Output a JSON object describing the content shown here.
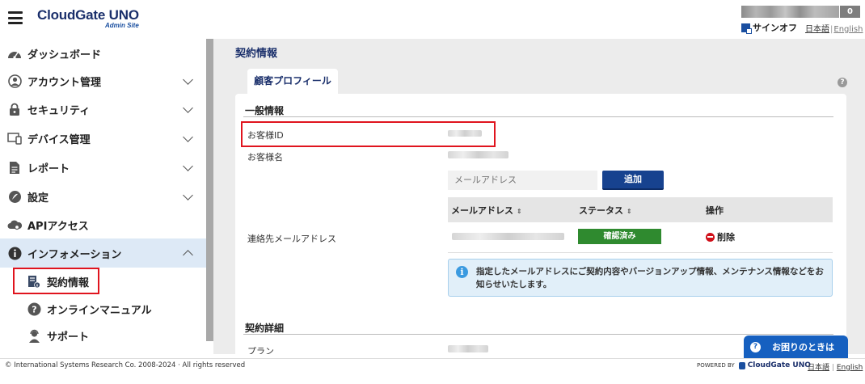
{
  "header": {
    "logo_main": "CloudGate UNO",
    "logo_sub": "Admin Site",
    "user_count": "0",
    "signoff_label": "サインオフ",
    "lang_ja": "日本語",
    "lang_separator": "|",
    "lang_en": "English"
  },
  "sidebar": {
    "items": [
      {
        "label": "ダッシュボード",
        "icon": "dashboard-gauge-icon"
      },
      {
        "label": "アカウント管理",
        "icon": "user-circle-icon"
      },
      {
        "label": "セキュリティ",
        "icon": "lock-icon"
      },
      {
        "label": "デバイス管理",
        "icon": "device-icon"
      },
      {
        "label": "レポート",
        "icon": "document-icon"
      },
      {
        "label": "設定",
        "icon": "settings-icon"
      },
      {
        "label": "APIアクセス",
        "icon": "cloud-gear-icon"
      },
      {
        "label": "インフォメーション",
        "icon": "info-icon"
      }
    ],
    "sub_items": [
      {
        "label": "契約情報",
        "icon": "contract-icon"
      },
      {
        "label": "オンラインマニュアル",
        "icon": "question-icon"
      },
      {
        "label": "サポート",
        "icon": "support-agent-icon"
      }
    ]
  },
  "main": {
    "page_title": "契約情報",
    "tab_label": "顧客プロフィール",
    "help_icon": "?",
    "section_general": "一般情報",
    "customer_id_label": "お客様ID",
    "customer_name_label": "お客様名",
    "contact_email_label": "連絡先メールアドレス",
    "email_placeholder": "メールアドレス",
    "add_button": "追加",
    "table_headers": {
      "email": "メールアドレス",
      "status": "ステータス",
      "action": "操作",
      "sort_mark": "⇕"
    },
    "row_status": "確認済み",
    "row_delete": "削除",
    "info_text": "指定したメールアドレスにご契約内容やバージョンアップ情報、メンテナンス情報などをお知らせいたします。",
    "section_details": "契約詳細",
    "plan_label": "プラン"
  },
  "help_float": "お困りのときは",
  "footer": {
    "copyright": "© International Systems Research Co.  2008-2024 · All rights reserved",
    "powered_by": "POWERED BY",
    "powered_brand": "CloudGate UNO",
    "lang_ja": "日本語",
    "lang_separator": "|",
    "lang_en": "English"
  },
  "colors": {
    "brand_navy": "#1a2f6b",
    "button_blue": "#17428f",
    "status_green": "#2f8a2f",
    "highlight_red": "#e0141e",
    "active_sidebar_bg": "#dde9f6",
    "info_bg": "#e1eff9"
  }
}
